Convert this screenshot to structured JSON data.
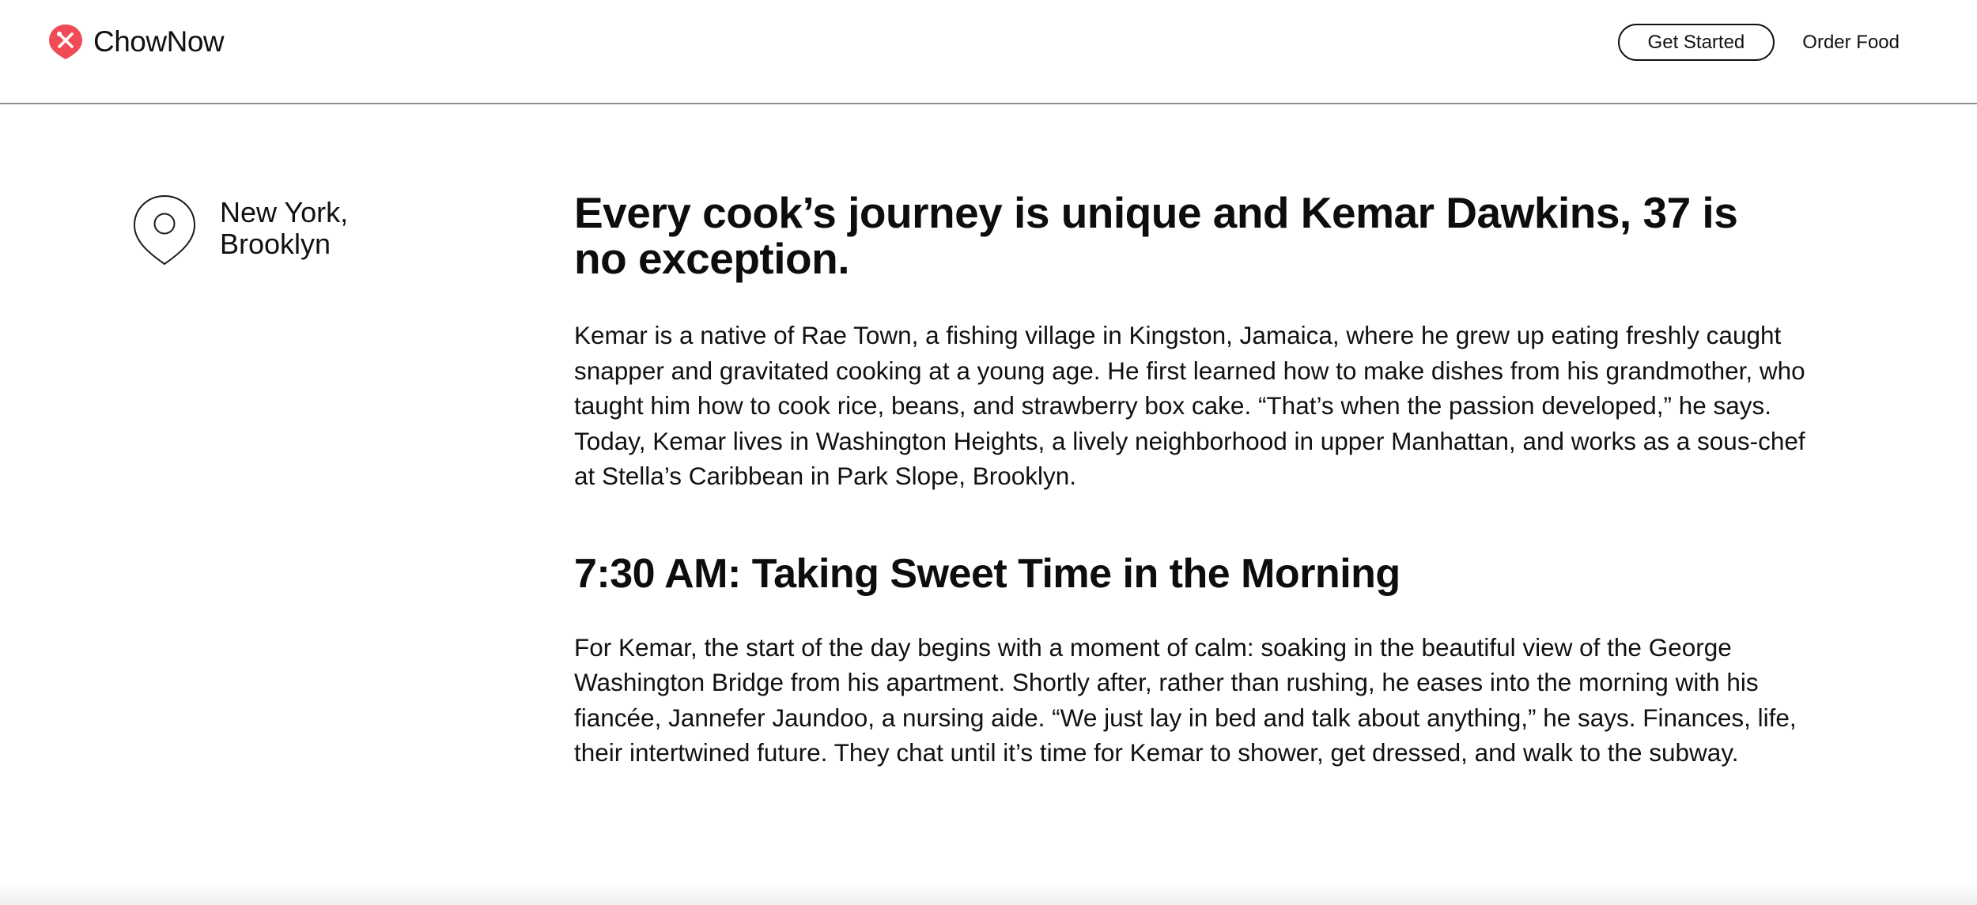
{
  "header": {
    "brand_name": "ChowNow",
    "brand_icon": "chownow-logo-icon",
    "brand_color": "#f04b56",
    "get_started_label": "Get Started",
    "order_food_label": "Order Food"
  },
  "location": {
    "icon": "map-pin-icon",
    "line1": "New York,",
    "line2": "Brooklyn"
  },
  "article": {
    "headline": "Every cook’s journey is unique and Kemar Dawkins, 37 is no exception.",
    "intro": "Kemar is a native of Rae Town, a fishing village in Kingston, Jamaica, where he grew up eating freshly caught snapper and gravitated cooking at a young age. He first learned how to make dishes from his grandmother, who taught him how to cook rice, beans, and strawberry box cake. “That’s when the passion developed,” he says. Today, Kemar lives in Washington Heights, a lively neighborhood in upper Manhattan, and works as a sous-chef at Stella’s Caribbean in Park Slope, Brooklyn.",
    "section_heading": "7:30 AM: Taking Sweet Time in the Morning",
    "section_body": "For Kemar, the start of the day begins with a moment of calm: soaking in the beautiful view of the George Washington Bridge from his apartment. Shortly after, rather than rushing, he eases into the morning with his fiancée, Jannefer Jaundoo, a nursing aide. “We just lay in bed and talk about anything,” he says. Finances, life, their intertwined future. They chat until it’s time for Kemar to shower, get dressed, and walk to the subway."
  }
}
